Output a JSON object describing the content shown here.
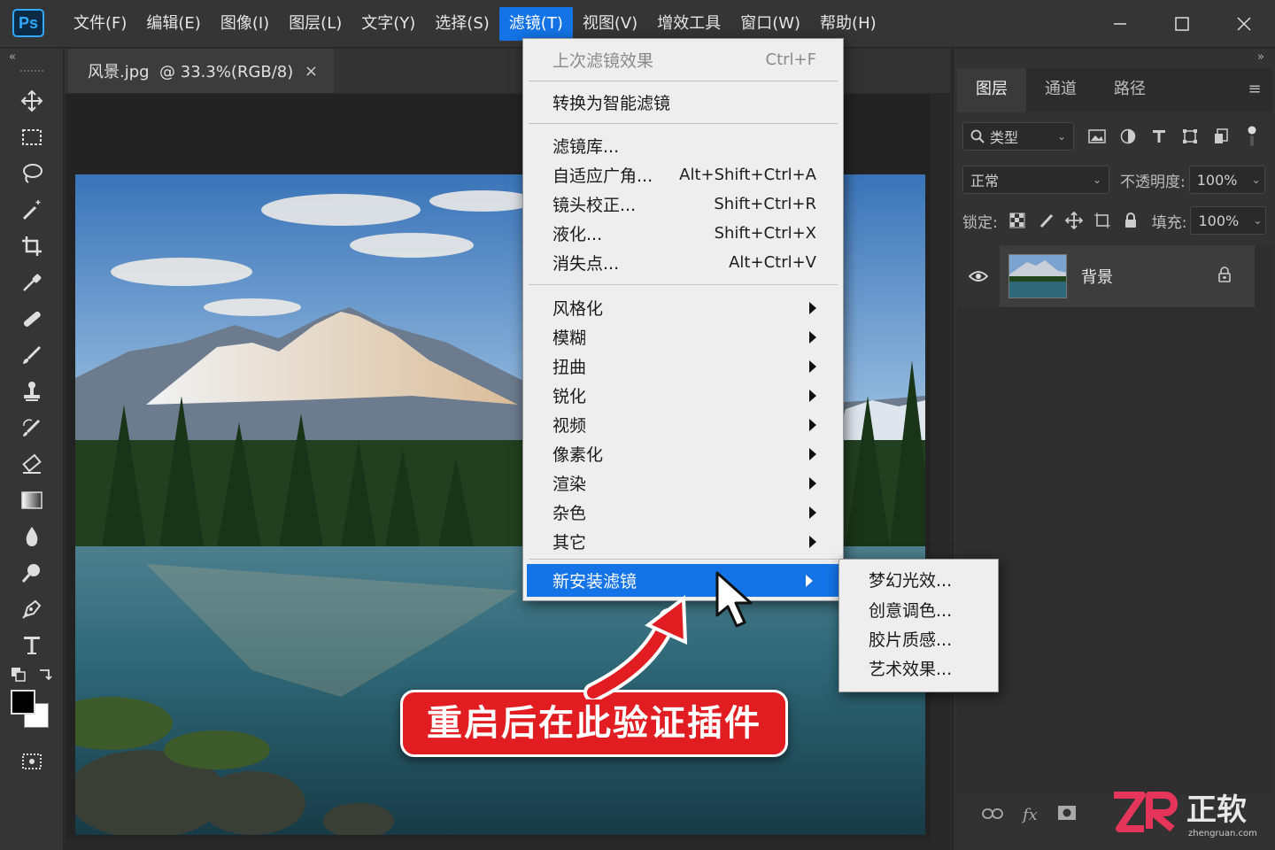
{
  "app": {
    "logo": "Ps"
  },
  "menubar": {
    "items": [
      "文件(F)",
      "编辑(E)",
      "图像(I)",
      "图层(L)",
      "文字(Y)",
      "选择(S)",
      "滤镜(T)",
      "视图(V)",
      "增效工具",
      "窗口(W)",
      "帮助(H)"
    ],
    "active_index": 6
  },
  "window_controls": [
    "minimize-icon",
    "maximize-icon",
    "close-icon"
  ],
  "toolbar": {
    "collapse_label": "«",
    "tools": [
      "move-icon",
      "marquee-icon",
      "lasso-icon",
      "magic-wand-icon",
      "crop-icon",
      "eyedropper-icon",
      "healing-brush-icon",
      "brush-icon",
      "clone-stamp-icon",
      "history-brush-icon",
      "eraser-icon",
      "gradient-icon",
      "blur-icon",
      "dodge-icon",
      "pen-icon",
      "type-icon"
    ],
    "foreground_color": "#000000",
    "background_color": "#ffffff"
  },
  "document": {
    "tab_title": "风景.jpg  @ 33.3%(RGB/8)",
    "close_label": "×",
    "callout": "重启后在此验证插件"
  },
  "filter_menu": {
    "last_filter": {
      "label": "上次滤镜效果",
      "shortcut": "Ctrl+F",
      "disabled": true
    },
    "smart_filter": "转换为智能滤镜",
    "group1": [
      {
        "label": "滤镜库...",
        "shortcut": ""
      },
      {
        "label": "自适应广角...",
        "shortcut": "Alt+Shift+Ctrl+A"
      },
      {
        "label": "镜头校正...",
        "shortcut": "Shift+Ctrl+R"
      },
      {
        "label": "液化...",
        "shortcut": "Shift+Ctrl+X"
      },
      {
        "label": "消失点...",
        "shortcut": "Alt+Ctrl+V"
      }
    ],
    "submenus": [
      "风格化",
      "模糊",
      "扭曲",
      "锐化",
      "视频",
      "像素化",
      "渲染",
      "杂色",
      "其它"
    ],
    "highlighted": "新安装滤镜",
    "highlighted_submenu_items": [
      "梦幻光效...",
      "创意调色...",
      "胶片质感...",
      "艺术效果..."
    ]
  },
  "layers_panel": {
    "tabs": [
      "图层",
      "通道",
      "路径"
    ],
    "active_tab": 0,
    "collapse_label": "»",
    "filter_kind": "类型",
    "blend_mode": "正常",
    "opacity_label": "不透明度:",
    "opacity_value": "100%",
    "lock_label": "锁定:",
    "fill_label": "填充:",
    "fill_value": "100%",
    "layers": [
      {
        "name": "背景",
        "visible": true,
        "locked": true
      }
    ],
    "bottom_icons": [
      "link-icon",
      "fx-icon",
      "mask-icon"
    ],
    "fx_label": "fx"
  },
  "watermark": {
    "text": "正软",
    "sub": "zhengruan.com"
  },
  "colors": {
    "accent": "#1473e6",
    "callout_red": "#e11d21"
  }
}
